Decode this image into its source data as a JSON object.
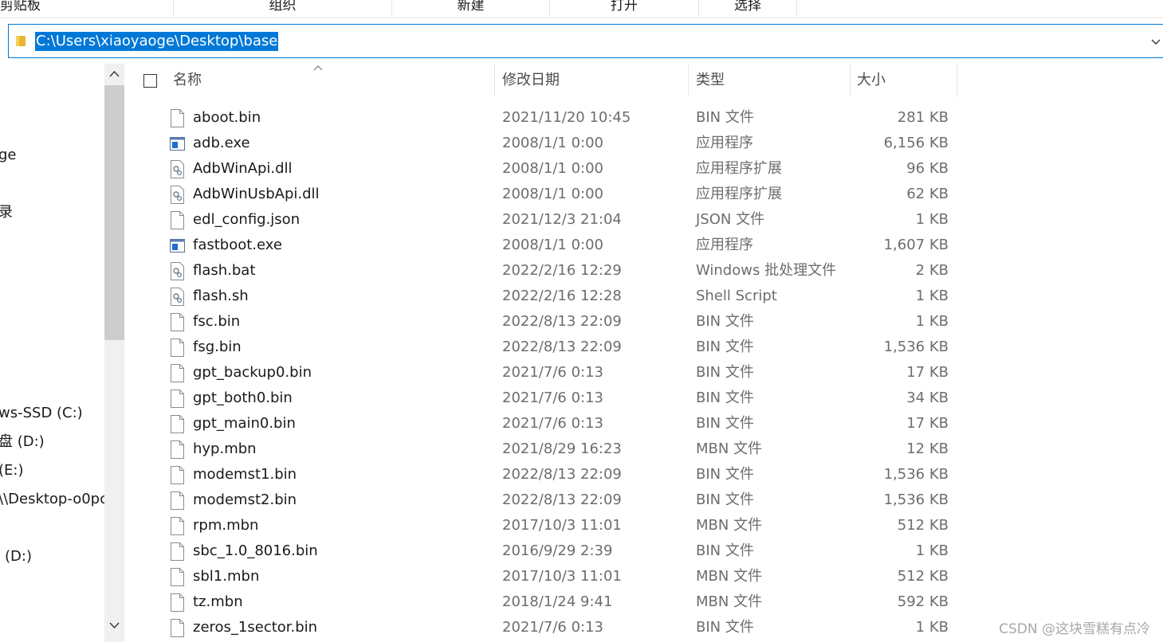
{
  "ribbon": {
    "groups": [
      "剪贴板",
      "组织",
      "新建",
      "打开",
      "选择"
    ]
  },
  "address_bar": {
    "path": "C:\\Users\\xiaoyaoge\\Desktop\\base",
    "folder_icon": "folder-icon",
    "dropdown_icon": "chevron-down-icon"
  },
  "nav": {
    "items": [
      "ge",
      "录",
      "ws-SSD (C:)",
      "盘 (D:)",
      "(E:)",
      "\\\\Desktop-o0pc",
      "(D:)"
    ]
  },
  "columns": {
    "name": "名称",
    "date": "修改日期",
    "type": "类型",
    "size": "大小"
  },
  "files": [
    {
      "name": "aboot.bin",
      "date": "2021/11/20 10:45",
      "type": "BIN 文件",
      "size": "281 KB",
      "icon": "file-icon"
    },
    {
      "name": "adb.exe",
      "date": "2008/1/1 0:00",
      "type": "应用程序",
      "size": "6,156 KB",
      "icon": "exe-icon"
    },
    {
      "name": "AdbWinApi.dll",
      "date": "2008/1/1 0:00",
      "type": "应用程序扩展",
      "size": "96 KB",
      "icon": "gear-file-icon"
    },
    {
      "name": "AdbWinUsbApi.dll",
      "date": "2008/1/1 0:00",
      "type": "应用程序扩展",
      "size": "62 KB",
      "icon": "gear-file-icon"
    },
    {
      "name": "edl_config.json",
      "date": "2021/12/3 21:04",
      "type": "JSON 文件",
      "size": "1 KB",
      "icon": "file-icon"
    },
    {
      "name": "fastboot.exe",
      "date": "2008/1/1 0:00",
      "type": "应用程序",
      "size": "1,607 KB",
      "icon": "exe-icon"
    },
    {
      "name": "flash.bat",
      "date": "2022/2/16 12:29",
      "type": "Windows 批处理文件",
      "size": "2 KB",
      "icon": "gear-file-icon"
    },
    {
      "name": "flash.sh",
      "date": "2022/2/16 12:28",
      "type": "Shell Script",
      "size": "1 KB",
      "icon": "gear-file-icon"
    },
    {
      "name": "fsc.bin",
      "date": "2022/8/13 22:09",
      "type": "BIN 文件",
      "size": "1 KB",
      "icon": "file-icon"
    },
    {
      "name": "fsg.bin",
      "date": "2022/8/13 22:09",
      "type": "BIN 文件",
      "size": "1,536 KB",
      "icon": "file-icon"
    },
    {
      "name": "gpt_backup0.bin",
      "date": "2021/7/6 0:13",
      "type": "BIN 文件",
      "size": "17 KB",
      "icon": "file-icon"
    },
    {
      "name": "gpt_both0.bin",
      "date": "2021/7/6 0:13",
      "type": "BIN 文件",
      "size": "34 KB",
      "icon": "file-icon"
    },
    {
      "name": "gpt_main0.bin",
      "date": "2021/7/6 0:13",
      "type": "BIN 文件",
      "size": "17 KB",
      "icon": "file-icon"
    },
    {
      "name": "hyp.mbn",
      "date": "2021/8/29 16:23",
      "type": "MBN 文件",
      "size": "12 KB",
      "icon": "file-icon"
    },
    {
      "name": "modemst1.bin",
      "date": "2022/8/13 22:09",
      "type": "BIN 文件",
      "size": "1,536 KB",
      "icon": "file-icon"
    },
    {
      "name": "modemst2.bin",
      "date": "2022/8/13 22:09",
      "type": "BIN 文件",
      "size": "1,536 KB",
      "icon": "file-icon"
    },
    {
      "name": "rpm.mbn",
      "date": "2017/10/3 11:01",
      "type": "MBN 文件",
      "size": "512 KB",
      "icon": "file-icon"
    },
    {
      "name": "sbc_1.0_8016.bin",
      "date": "2016/9/29 2:39",
      "type": "BIN 文件",
      "size": "1 KB",
      "icon": "file-icon"
    },
    {
      "name": "sbl1.mbn",
      "date": "2017/10/3 11:01",
      "type": "MBN 文件",
      "size": "512 KB",
      "icon": "file-icon"
    },
    {
      "name": "tz.mbn",
      "date": "2018/1/24 9:41",
      "type": "MBN 文件",
      "size": "592 KB",
      "icon": "file-icon"
    },
    {
      "name": "zeros_1sector.bin",
      "date": "2021/7/6 0:13",
      "type": "BIN 文件",
      "size": "1 KB",
      "icon": "file-icon"
    }
  ],
  "watermark": "CSDN @这块雪糕有点冷",
  "colors": {
    "accent": "#0078d7",
    "muted_text": "#6d6d6d",
    "scrollbar_thumb": "#cdcdcd"
  }
}
